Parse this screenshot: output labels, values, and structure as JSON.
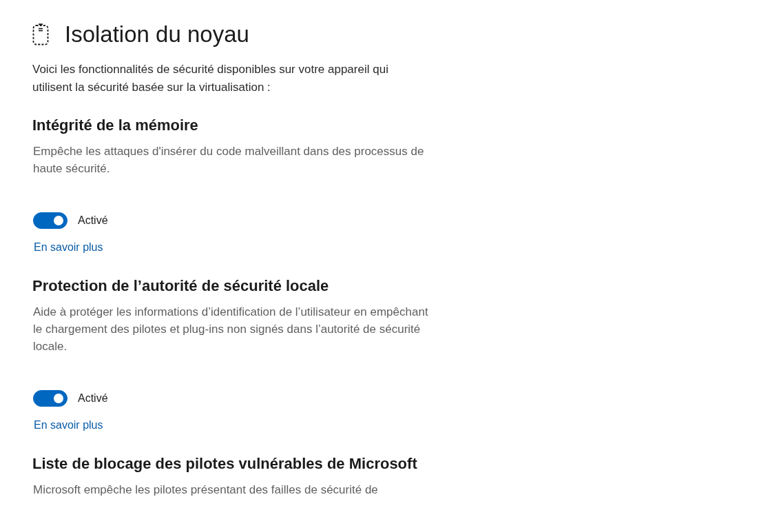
{
  "page": {
    "title": "Isolation du noyau",
    "intro": "Voici les fonctionnalités de sécurité disponibles sur votre appareil qui utilisent la sécurité basée sur la virtualisation :"
  },
  "sections": [
    {
      "heading": "Intégrité de la mémoire",
      "description": "Empêche les attaques d'insérer du code malveillant dans des processus de haute sécurité.",
      "toggle": {
        "on": true,
        "label": "Activé"
      },
      "link": "En savoir plus"
    },
    {
      "heading": "Protection de l’autorité de sécurité locale",
      "description": "Aide à protéger les informations d’identification de l’utilisateur en empêchant le chargement des pilotes et plug-ins non signés dans l’autorité de sécurité locale.",
      "toggle": {
        "on": true,
        "label": "Activé"
      },
      "link": "En savoir plus"
    },
    {
      "heading": "Liste de blocage des pilotes vulnérables de Microsoft",
      "description": "Microsoft empêche les pilotes présentant des failles de sécurité de"
    }
  ]
}
